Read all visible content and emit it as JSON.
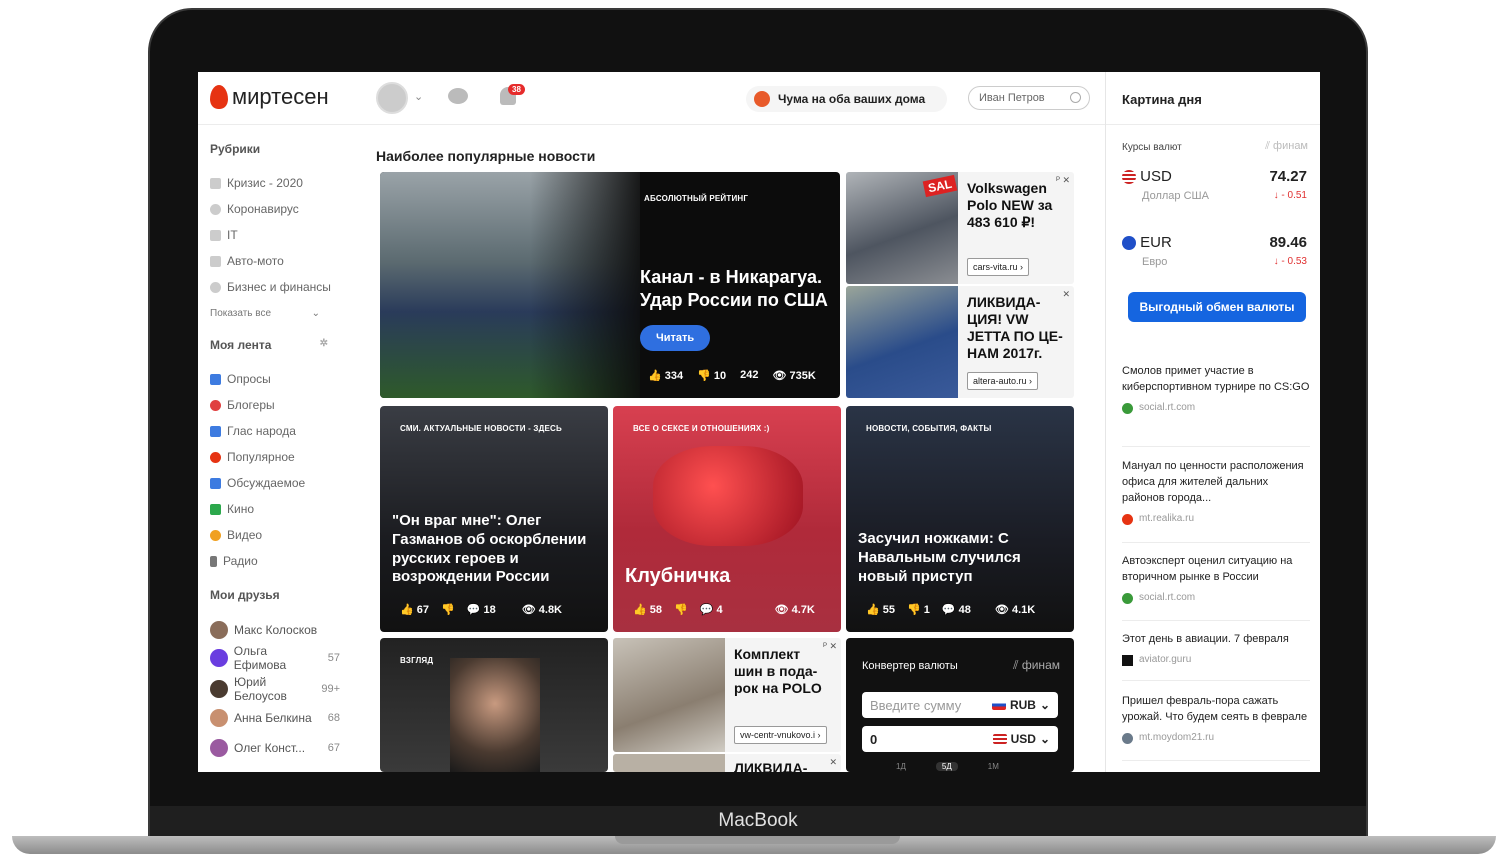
{
  "header": {
    "logo": "миртесен",
    "notif_count": "38",
    "promo": "Чума на оба ваших дома",
    "search_value": "Иван Петров"
  },
  "sidebar": {
    "rubrics_title": "Рубрики",
    "rubrics": [
      "Кризис - 2020",
      "Коронавирус",
      "IT",
      "Авто-мото",
      "Бизнес и финансы"
    ],
    "show_all": "Показать все",
    "feed_title": "Моя лента",
    "feed": [
      "Опросы",
      "Блогеры",
      "Глас народа",
      "Популярное",
      "Обсуждаемое",
      "Кино",
      "Видео",
      "Радио"
    ],
    "friends_title": "Мои друзья",
    "friends": [
      {
        "name": "Макс Колосков",
        "count": ""
      },
      {
        "name": "Ольга Ефимова",
        "count": "57"
      },
      {
        "name": "Юрий Белоусов",
        "count": "99+"
      },
      {
        "name": "Анна Белкина",
        "count": "68"
      },
      {
        "name": "Олег Конст...",
        "count": "67"
      }
    ]
  },
  "main": {
    "title": "Наиболее популярные новости",
    "hero": {
      "tag": "АБСОЛЮТНЫЙ РЕЙТИНГ",
      "title": "Канал - в Никарагуа. Удар России по США",
      "read": "Читать",
      "likes": "334",
      "dislikes": "10",
      "comments": "242",
      "views": "735K"
    },
    "cards": [
      {
        "tag": "СМИ. АКТУАЛЬНЫЕ НОВОСТИ - ЗДЕСЬ",
        "title": "\"Он враг мне\": Олег Газманов об оскорблении русских героев и возрождении России",
        "likes": "67",
        "comments": "18",
        "views": "4.8K"
      },
      {
        "tag": "ВСЕ О СЕКСЕ И ОТНОШЕНИЯХ :)",
        "title": "Клубничка",
        "likes": "58",
        "comments": "4",
        "views": "4.7K"
      },
      {
        "tag": "НОВОСТИ, СОБЫТИЯ, ФАКТЫ",
        "title": "Засучил ножками: С Навальным случился новый приступ",
        "likes": "55",
        "dislikes": "1",
        "comments": "48",
        "views": "4.1K"
      },
      {
        "tag": "ВЗГЛЯД"
      }
    ],
    "ads": [
      {
        "title": "Volkswagen Polo NEW за 483 610 ₽!",
        "link": "cars-vita.ru ›",
        "badge": "SAL"
      },
      {
        "title": "ЛИКВИДА-ЦИЯ! VW JETTA ПО ЦЕ-НАМ 2017г.",
        "link": "altera-auto.ru ›"
      },
      {
        "title": "Комплект шин в пода-рок на POLO",
        "link": "vw-centr-vnukovo.i ›"
      },
      {
        "title": "ЛИКВИДА-"
      }
    ],
    "converter": {
      "title": "Конвертер валюты",
      "brand": "финам",
      "placeholder": "Введите сумму",
      "from": "RUB",
      "to_value": "0",
      "to": "USD",
      "periods": [
        "1Д",
        "5Д",
        "1М"
      ]
    }
  },
  "right": {
    "title": "Картина дня",
    "rates_title": "Курсы валют",
    "brand": "финам",
    "rates": [
      {
        "code": "USD",
        "name": "Доллар США",
        "value": "74.27",
        "delta": "↓ - 0.51"
      },
      {
        "code": "EUR",
        "name": "Евро",
        "value": "89.46",
        "delta": "↓ - 0.53"
      }
    ],
    "exchange_button": "Выгодный обмен валюты",
    "news": [
      {
        "title": "Смолов примет участие в киберспортивном турнире по CS:GO",
        "src": "social.rt.com"
      },
      {
        "title": "Мануал по ценности расположения офиса для жителей дальних районов города...",
        "src": "mt.realika.ru"
      },
      {
        "title": "Автоэксперт оценил ситуацию на вторичном рынке в России",
        "src": "social.rt.com"
      },
      {
        "title": "Этот день в авиации. 7 февраля",
        "src": "aviator.guru"
      },
      {
        "title": "Пришел февраль-пора сажать урожай. Что будем сеять в феврале",
        "src": "mt.moydom21.ru"
      }
    ]
  },
  "device": {
    "brand": "MacBook"
  },
  "colors": {
    "accent": "#2f6fe0",
    "logo": "#e63312",
    "down": "#e03030"
  }
}
